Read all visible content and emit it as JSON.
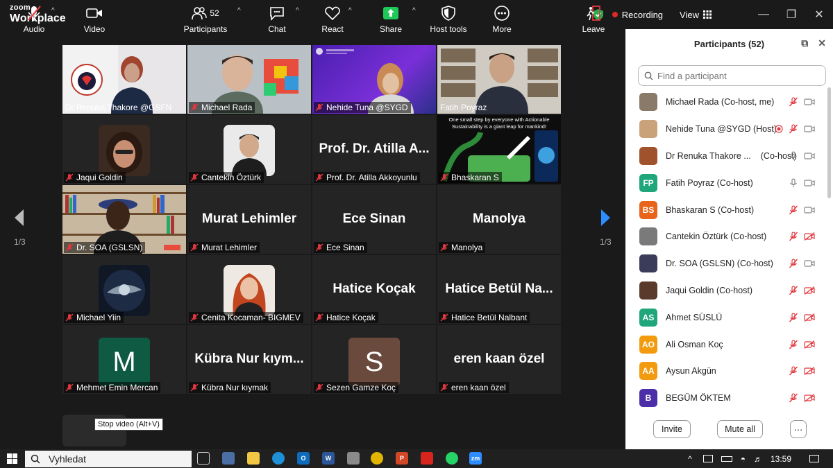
{
  "app": {
    "brand_line1": "zoom",
    "brand_line2": "Workplace",
    "recording_label": "Recording",
    "view_label": "View"
  },
  "grid": {
    "page_left": "1/3",
    "page_right": "1/3",
    "tiles": [
      {
        "name": "Dr Renuka Thakore @GSFN",
        "big": "",
        "active": true,
        "muted": false
      },
      {
        "name": "Michael Rada",
        "big": "",
        "muted": true
      },
      {
        "name": "Nehide Tuna @SYGD",
        "big": "",
        "muted": true
      },
      {
        "name": "Fatih Poyraz",
        "big": "",
        "muted": false
      },
      {
        "name": "Jaqui Goldin",
        "big": "",
        "muted": true
      },
      {
        "name": "Cantekin Öztürk",
        "big": "",
        "muted": true
      },
      {
        "name": "Prof. Dr. Atilla Akkoyunlu",
        "big": "Prof. Dr. Atilla A...",
        "muted": true
      },
      {
        "name": "Bhaskaran S",
        "big": "",
        "muted": true
      },
      {
        "name": "Dr. SOA (GSLSN)",
        "big": "",
        "muted": true
      },
      {
        "name": "Murat Lehimler",
        "big": "Murat Lehimler",
        "muted": true
      },
      {
        "name": "Ece Sinan",
        "big": "Ece Sinan",
        "muted": true
      },
      {
        "name": "Manolya",
        "big": "Manolya",
        "muted": true
      },
      {
        "name": "Michael Yiin",
        "big": "",
        "muted": true
      },
      {
        "name": "Cenita Kocaman- BIGMEV",
        "big": "",
        "muted": true
      },
      {
        "name": "Hatice Koçak",
        "big": "Hatice Koçak",
        "muted": true
      },
      {
        "name": "Hatice Betül Nalbant",
        "big": "Hatice Betül Na...",
        "muted": true
      },
      {
        "name": "Mehmet Emin Mercan",
        "big": "",
        "letter": "M",
        "muted": true
      },
      {
        "name": "Kübra Nur kıymak",
        "big": "Kübra Nur kıym...",
        "muted": true
      },
      {
        "name": "Sezen Gamze Koç",
        "big": "",
        "letter": "S",
        "muted": true
      },
      {
        "name": "eren kaan özel",
        "big": "eren kaan özel",
        "muted": true
      }
    ],
    "slide_text_1": "One small step by everyone with Actionable",
    "slide_text_2": "Sustainability is a giant leap for mankind!"
  },
  "toolbar": {
    "audio": "Audio",
    "video": "Video",
    "video_tooltip": "Stop video (Alt+V)",
    "participants": "Participants",
    "participants_count": "52",
    "chat": "Chat",
    "react": "React",
    "share": "Share",
    "host_tools": "Host tools",
    "more": "More",
    "leave": "Leave"
  },
  "panel": {
    "title": "Participants (52)",
    "search_placeholder": "Find a participant",
    "invite": "Invite",
    "mute_all": "Mute all",
    "participants": [
      {
        "name": "Michael Rada (Co-host, me)",
        "initials": "",
        "color": "#8a7a6a",
        "mic": "off",
        "cam": "on"
      },
      {
        "name": "Nehide Tuna @SYGD (Host)",
        "initials": "",
        "color": "#c9a27a",
        "mic": "off",
        "cam": "on",
        "recording": true
      },
      {
        "name": "Dr Renuka Thakore ...",
        "suffix": "(Co-host)",
        "initials": "",
        "color": "#a0522d",
        "mic": "on",
        "cam": "on"
      },
      {
        "name": "Fatih Poyraz (Co-host)",
        "initials": "FP",
        "color": "#1fa67a",
        "mic": "on",
        "cam": "on"
      },
      {
        "name": "Bhaskaran S (Co-host)",
        "initials": "BS",
        "color": "#e8641b",
        "mic": "off",
        "cam": "on"
      },
      {
        "name": "Cantekin Öztürk (Co-host)",
        "initials": "",
        "color": "#7a7a7a",
        "mic": "off",
        "cam": "off"
      },
      {
        "name": "Dr. SOA (GSLSN) (Co-host)",
        "initials": "",
        "color": "#3b3b5a",
        "mic": "off",
        "cam": "on"
      },
      {
        "name": "Jaqui Goldin (Co-host)",
        "initials": "",
        "color": "#5a3a2a",
        "mic": "off",
        "cam": "off"
      },
      {
        "name": "Ahmet SÜSLÜ",
        "initials": "AS",
        "color": "#1fa67a",
        "mic": "off",
        "cam": "off"
      },
      {
        "name": "Ali Osman Koç",
        "initials": "AO",
        "color": "#f29b0f",
        "mic": "off",
        "cam": "off"
      },
      {
        "name": "Aysun Akgün",
        "initials": "AA",
        "color": "#f29b0f",
        "mic": "off",
        "cam": "off"
      },
      {
        "name": "BEGÜM ÖKTEM",
        "initials": "B",
        "color": "#4b2ea8",
        "mic": "off",
        "cam": "off"
      }
    ]
  },
  "taskbar": {
    "search_label": "Vyhledat",
    "time": "13:59"
  },
  "colors": {
    "accent_green": "#2ecc71",
    "mute_red": "#e0383e",
    "leave_red": "#e0383e",
    "share_green": "#1ec95a"
  }
}
